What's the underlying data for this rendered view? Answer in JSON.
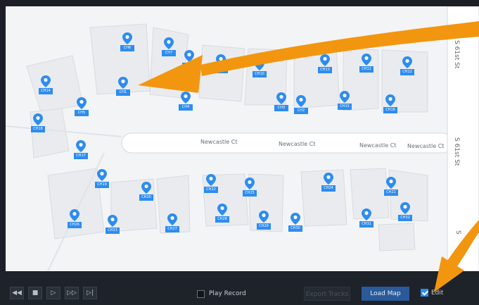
{
  "streets": {
    "newcastle_1": "Newcastle Ct",
    "newcastle_2": "Newcastle Ct",
    "newcastle_3": "Newcastle Ct",
    "newcastle_4": "Newcastle Ct",
    "s61st_top": "S 61st St",
    "s61st_mid": "S 61st St",
    "s61st_bottom": "S"
  },
  "cameras": [
    {
      "label": "CH6"
    },
    {
      "label": "CH7"
    },
    {
      "label": "CH8"
    },
    {
      "label": "CH9"
    },
    {
      "label": "CH10"
    },
    {
      "label": "CH13"
    },
    {
      "label": "CH11"
    },
    {
      "label": "CH12"
    },
    {
      "label": "CH14"
    },
    {
      "label": "CH1"
    },
    {
      "label": "CH5"
    },
    {
      "label": "CH4"
    },
    {
      "label": "CH3"
    },
    {
      "label": "CH2"
    },
    {
      "label": "CH15"
    },
    {
      "label": "CH16"
    },
    {
      "label": "CH18"
    },
    {
      "label": "CH17"
    },
    {
      "label": "CH19"
    },
    {
      "label": "CH20"
    },
    {
      "label": "CH22"
    },
    {
      "label": "CH25"
    },
    {
      "label": "CH24"
    },
    {
      "label": "CH21"
    },
    {
      "label": "CH26"
    },
    {
      "label": "CH23"
    },
    {
      "label": "CH27"
    },
    {
      "label": "CH28"
    },
    {
      "label": "CH29"
    },
    {
      "label": "CH30"
    },
    {
      "label": "CH31"
    },
    {
      "label": "CH32"
    }
  ],
  "toolbar": {
    "buttons": [
      "rewind-icon",
      "stop-icon",
      "play-icon",
      "fast-forward-icon",
      "next-frame-icon"
    ],
    "play_record_label": "Play Record",
    "play_record_checked": false,
    "export_tracks_label": "Export Tracks",
    "load_map_label": "Load Map",
    "edit_label": "Edit",
    "edit_checked": true
  },
  "colors": {
    "accent": "#2d8cf0",
    "annotation_arrow": "#f2960f",
    "toolbar_bg": "#1e232a",
    "map_bg": "#f3f4f6"
  }
}
